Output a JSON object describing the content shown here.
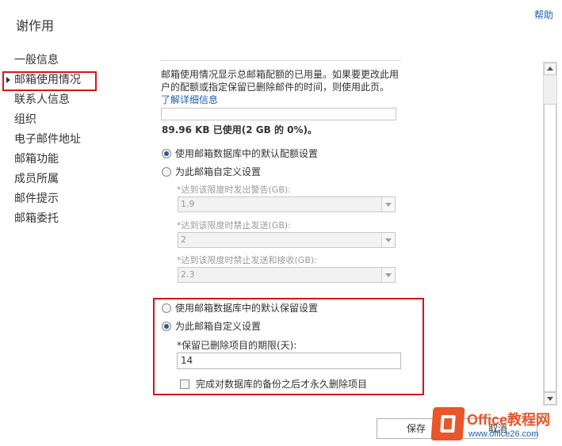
{
  "header": {
    "title": "谢作用",
    "help_label": "帮助"
  },
  "sidebar": {
    "items": [
      {
        "label": "一般信息",
        "selected": false
      },
      {
        "label": "邮箱使用情况",
        "selected": true
      },
      {
        "label": "联系人信息",
        "selected": false
      },
      {
        "label": "组织",
        "selected": false
      },
      {
        "label": "电子邮件地址",
        "selected": false
      },
      {
        "label": "邮箱功能",
        "selected": false
      },
      {
        "label": "成员所属",
        "selected": false
      },
      {
        "label": "邮件提示",
        "selected": false
      },
      {
        "label": "邮箱委托",
        "selected": false
      }
    ]
  },
  "usage": {
    "description": "邮箱使用情况显示总邮箱配额的已用量。如果要更改此用户的配额或指定保留已删除邮件的时间，则使用此页。",
    "learn_more_label": "了解详细信息",
    "usage_summary": "89.96 KB 已使用(2 GB 的 0%)。",
    "usage_fraction": 0.0
  },
  "quota": {
    "option_default": "使用邮箱数据库中的默认配额设置",
    "option_custom": "为此邮箱自定义设置",
    "selected": "default",
    "warning_label": "*达到该限度时发出警告(GB):",
    "warning_value": "1.9",
    "prohibit_send_label": "*达到该限度时禁止发送(GB):",
    "prohibit_send_value": "2",
    "prohibit_send_receive_label": "*达到该限度时禁止发送和接收(GB):",
    "prohibit_send_receive_value": "2.3"
  },
  "retention": {
    "option_default": "使用邮箱数据库中的默认保留设置",
    "option_custom": "为此邮箱自定义设置",
    "selected": "custom",
    "days_label": "*保留已删除项目的期限(天):",
    "days_value": "14",
    "backup_checkbox_label": "完成对数据库的备份之后才永久删除项目",
    "backup_checked": false
  },
  "footer": {
    "save_label": "保存",
    "cancel_label": "取消"
  },
  "watermark": {
    "title": "Office教程网",
    "url": "www.office26.com"
  },
  "colors": {
    "highlight": "#d6131b",
    "link": "#1f5fb4",
    "brand": "#e8562a"
  }
}
